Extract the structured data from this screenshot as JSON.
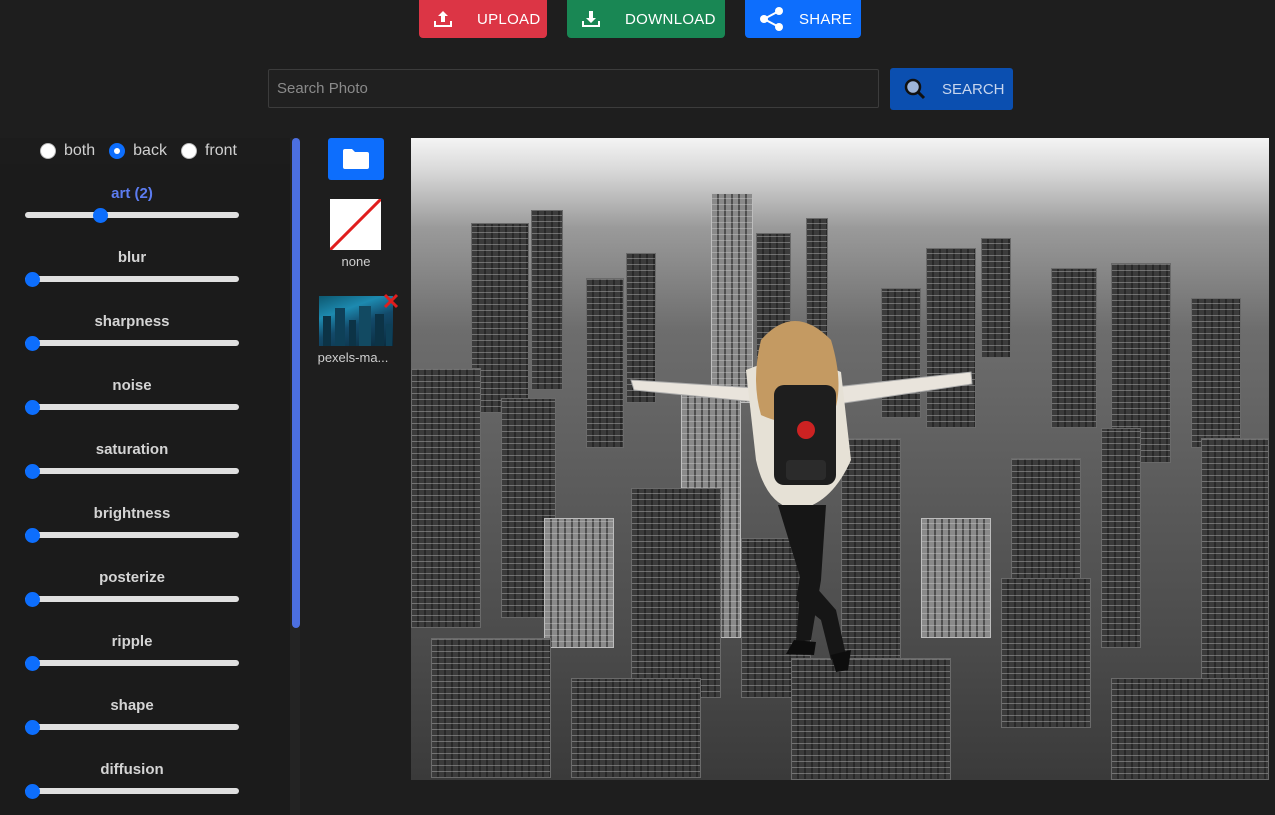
{
  "toolbar": {
    "upload_label": "UPLOAD",
    "download_label": "DOWNLOAD",
    "share_label": "SHARE"
  },
  "search": {
    "placeholder": "Search Photo",
    "value": "",
    "button_label": "SEARCH"
  },
  "mode": {
    "options": [
      "both",
      "back",
      "front"
    ],
    "selected": "back"
  },
  "sliders": [
    {
      "label": "art (2)",
      "value": 0.34,
      "active": true
    },
    {
      "label": "blur",
      "value": 0
    },
    {
      "label": "sharpness",
      "value": 0
    },
    {
      "label": "noise",
      "value": 0
    },
    {
      "label": "saturation",
      "value": 0
    },
    {
      "label": "brightness",
      "value": 0
    },
    {
      "label": "posterize",
      "value": 0
    },
    {
      "label": "ripple",
      "value": 0
    },
    {
      "label": "shape",
      "value": 0
    },
    {
      "label": "diffusion",
      "value": 0
    }
  ],
  "thumbnails": {
    "none_label": "none",
    "photo_label": "pexels-ma..."
  },
  "colors": {
    "upload": "#dc3545",
    "download": "#198754",
    "share": "#0d6efd",
    "slider_active_label": "#5c7cf0"
  }
}
